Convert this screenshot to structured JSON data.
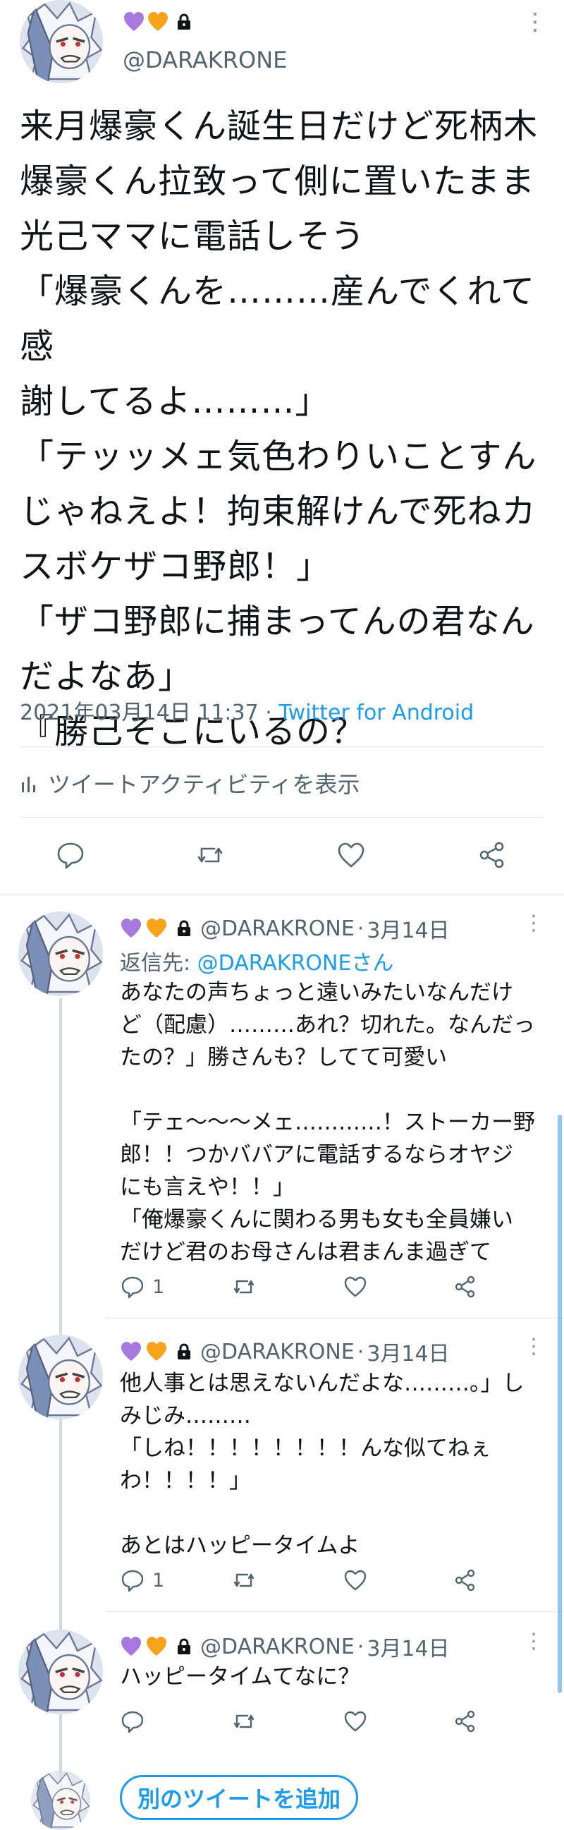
{
  "colors": {
    "accent": "#1d9bf0",
    "secondary_text": "#536471",
    "heart_purple": "#a779de",
    "heart_orange": "#f7a31c"
  },
  "main_tweet": {
    "display_name_icons": [
      "purple-heart-icon",
      "orange-heart-icon",
      "lock-icon"
    ],
    "handle": "@DARAKRONE",
    "text": "来月爆豪くん誕生日だけど死柄木\n爆豪くん拉致って側に置いたまま\n光己ママに電話しそう\n「爆豪くんを………産んでくれて感\n謝してるよ………」\n「テッッメェ気色わりいことすん\nじゃねえよ！拘束解けんで死ねカ\nスボケザコ野郎！」\n「ザコ野郎に捕まってんの君なん\nだよなあ」\n『勝己そこにいるの？",
    "timestamp": "2021年03月14日 11:37",
    "separator": " · ",
    "client": "Twitter for Android",
    "activity_label": "ツイートアクティビティを表示"
  },
  "replies": [
    {
      "handle": "@DARAKRONE",
      "date": "3月14日",
      "reply_to_prefix": "返信先: ",
      "reply_to_handle": "@DARAKRONEさん",
      "text": "あなたの声ちょっと遠いみたいなんだけ\nど（配慮）………あれ？切れた。なんだっ\nたの？」勝さんも？してて可愛い\n\n「テェ〜〜〜メェ…………！ストーカー野\n郎！！つかババアに電話するならオヤジ\nにも言えや！！」\n「俺爆豪くんに関わる男も女も全員嫌い\nだけど君のお母さんは君まんま過ぎて",
      "reply_count": "1"
    },
    {
      "handle": "@DARAKRONE",
      "date": "3月14日",
      "text": "他人事とは思えないんだよな………。」し\nみじみ………\n「しね！！！！！！！！んな似てねぇ\nわ！！！！」\n\nあとはハッピータイムよ",
      "reply_count": "1"
    },
    {
      "handle": "@DARAKRONE",
      "date": "3月14日",
      "text": "ハッピータイムてなに？",
      "reply_count": ""
    }
  ],
  "separator_dot": " · ",
  "add_tweet_label": "別のツイートを追加"
}
